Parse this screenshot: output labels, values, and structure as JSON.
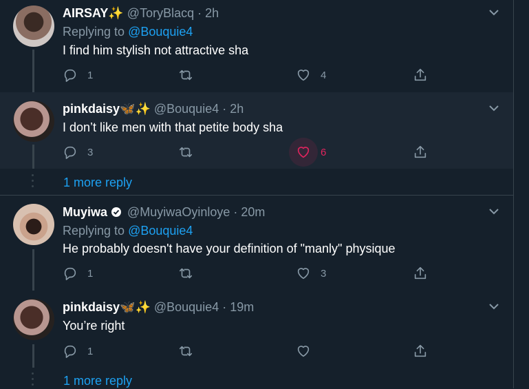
{
  "tweets": [
    {
      "name": "AIRSAY",
      "emoji": "✨",
      "handle": "@ToryBlacq · 2h",
      "replying_prefix": "Replying to ",
      "replying_handle": "@Bouquie4",
      "text": "I find him stylish not attractive sha",
      "replies": "1",
      "retweets": "",
      "likes": "4"
    },
    {
      "name": "pinkdaisy",
      "emoji": "🦋✨",
      "handle": "@Bouquie4 · 2h",
      "text": "I don’t like men with that petite body sha",
      "replies": "3",
      "retweets": "",
      "likes": "6"
    },
    {
      "name": "Muyiwa",
      "emoji": "",
      "handle": "@MuyiwaOyinloye · 20m",
      "replying_prefix": "Replying to ",
      "replying_handle": "@Bouquie4",
      "text": "He probably doesn't have your definition of \"manly\" physique",
      "replies": "1",
      "retweets": "",
      "likes": "3"
    },
    {
      "name": "pinkdaisy",
      "emoji": "🦋✨",
      "handle": "@Bouquie4 · 19m",
      "text": "You’re right",
      "replies": "1",
      "retweets": "",
      "likes": ""
    }
  ],
  "more_replies": [
    "1 more reply",
    "1 more reply"
  ],
  "colors": {
    "background": "#15202b",
    "highlight": "#1c2733",
    "link": "#1da1f2",
    "like": "#e0245e",
    "muted": "#8899a6"
  }
}
